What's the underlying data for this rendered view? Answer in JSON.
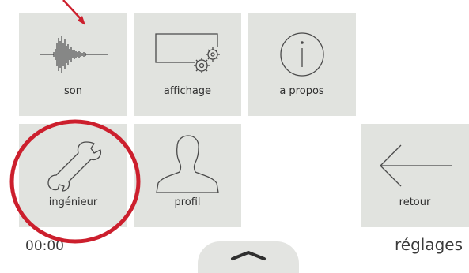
{
  "tiles": {
    "son": {
      "label": "son",
      "icon": "waveform-icon"
    },
    "affichage": {
      "label": "affichage",
      "icon": "display-settings-icon"
    },
    "apropos": {
      "label": "a propos",
      "icon": "info-icon"
    },
    "ingenieur": {
      "label": "ingénieur",
      "icon": "wrench-icon"
    },
    "profil": {
      "label": "profil",
      "icon": "person-icon"
    },
    "retour": {
      "label": "retour",
      "icon": "arrow-left-icon"
    }
  },
  "footer": {
    "time": "00:00",
    "title": "réglages"
  },
  "pull_tab": {
    "icon": "chevron-up-icon"
  },
  "annotation": {
    "color": "#cc1f2d"
  },
  "colors": {
    "tile_background": "#e1e3df",
    "icon_stroke": "#4a4a4a"
  }
}
